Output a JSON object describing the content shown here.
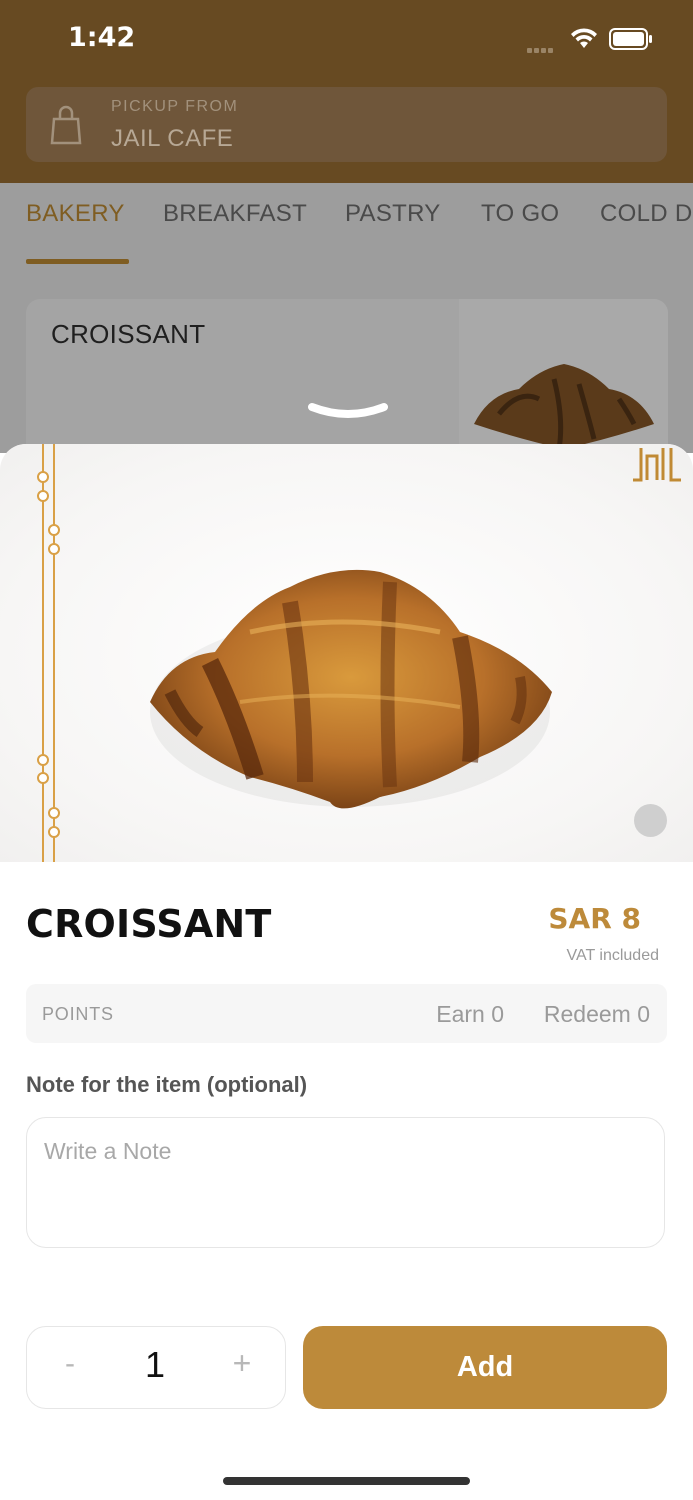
{
  "status_bar": {
    "time": "1:42"
  },
  "header": {
    "pickup_label": "PICKUP FROM",
    "pickup_location": "JAIL CAFE"
  },
  "tabs": [
    {
      "label": "BAKERY",
      "active": true
    },
    {
      "label": "BREAKFAST",
      "active": false
    },
    {
      "label": "PASTRY",
      "active": false
    },
    {
      "label": "TO GO",
      "active": false
    },
    {
      "label": "COLD D",
      "active": false
    }
  ],
  "menu_card": {
    "title": "CROISSANT"
  },
  "item": {
    "name": "CROISSANT",
    "price": "SAR 8",
    "vat_note": "VAT included"
  },
  "points": {
    "label": "POINTS",
    "earn": "Earn 0",
    "redeem": "Redeem 0"
  },
  "note": {
    "label": "Note for the item (optional)",
    "placeholder": "Write a Note",
    "value": ""
  },
  "quantity": {
    "minus": "-",
    "value": "1",
    "plus": "+"
  },
  "add_button": {
    "label": "Add"
  },
  "colors": {
    "brand": "#bd8a3a",
    "header": "#674a22"
  },
  "icons": [
    "shopping-bag-icon",
    "wifi-icon",
    "battery-icon",
    "chevron-down-icon",
    "jail-logo"
  ]
}
